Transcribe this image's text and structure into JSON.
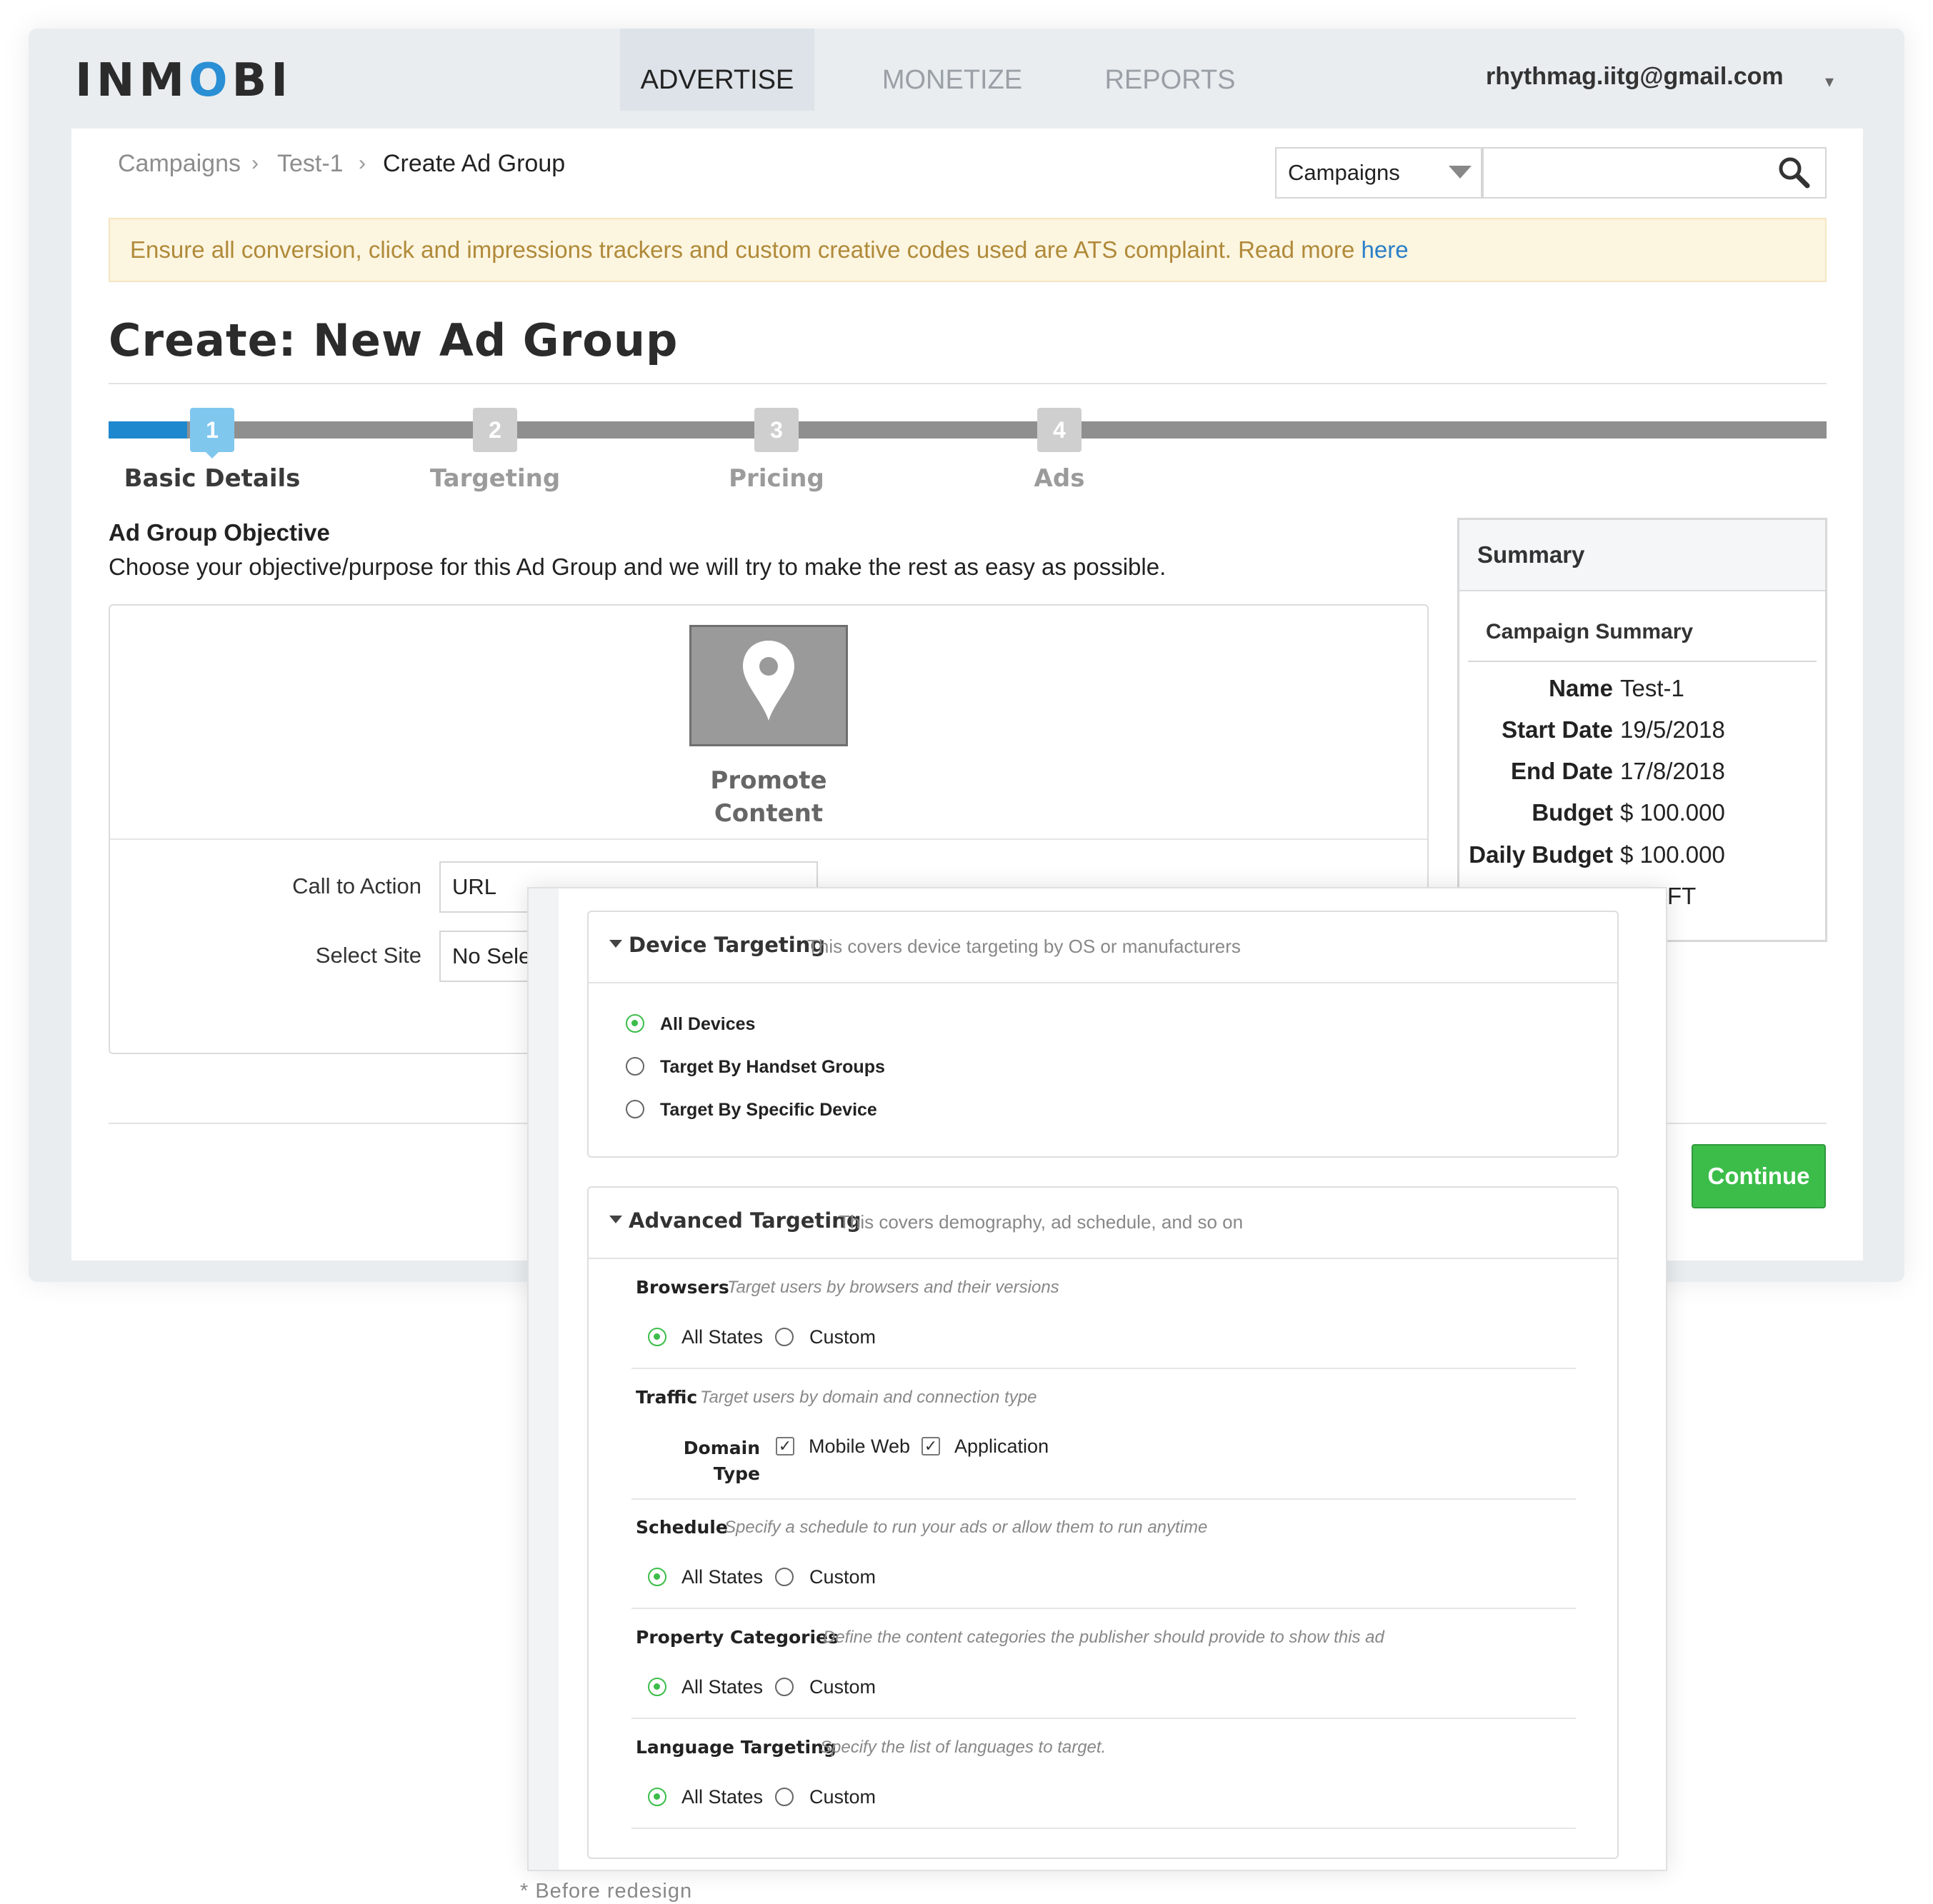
{
  "app": {
    "logo_text": "INMOBI",
    "brand_color": "#2a8fd4",
    "accent_color": "#1e88cf"
  },
  "nav": {
    "tabs": [
      {
        "label": "ADVERTISE",
        "active": true
      },
      {
        "label": "MONETIZE",
        "active": false
      },
      {
        "label": "REPORTS",
        "active": false
      }
    ],
    "user_email": "rhythmag.iitg@gmail.com",
    "user_caret": "▾"
  },
  "breadcrumb": {
    "items": [
      "Campaigns",
      "Test-1",
      "Create Ad Group"
    ],
    "separator": "›"
  },
  "search": {
    "scope": "Campaigns",
    "value": ""
  },
  "notice": {
    "text": "Ensure all conversion, click and impressions trackers and custom creative codes used are ATS complaint. Read more ",
    "link": "here"
  },
  "page": {
    "title": "Create: New Ad Group"
  },
  "steps": [
    {
      "number": "1",
      "label": "Basic Details",
      "active": true
    },
    {
      "number": "2",
      "label": "Targeting",
      "active": false
    },
    {
      "number": "3",
      "label": "Pricing",
      "active": false
    },
    {
      "number": "4",
      "label": "Ads",
      "active": false
    }
  ],
  "objective": {
    "heading": "Ad Group Objective",
    "description": "Choose your objective/purpose for this Ad Group and we will try to make the rest as easy as possible.",
    "option_line1": "Promote",
    "option_line2": "Content",
    "option_icon": "map-pin-icon"
  },
  "form": {
    "cta_label": "Call to Action",
    "cta_value": "URL",
    "site_label": "Select Site",
    "site_value": "No Sele"
  },
  "actions": {
    "continue_label": "Continue",
    "continue_color": "#3cbd4a"
  },
  "summary": {
    "title": "Summary",
    "campaign_title": "Campaign Summary",
    "rows": [
      {
        "key": "Name",
        "value": "Test-1"
      },
      {
        "key": "Start Date",
        "value": "19/5/2018"
      },
      {
        "key": "End Date",
        "value": "17/8/2018"
      },
      {
        "key": "Budget",
        "value": "$ 100.000"
      },
      {
        "key": "Daily Budget",
        "value": "$ 100.000"
      }
    ],
    "partial_text": "FT"
  },
  "device_targeting": {
    "title": "Device Targeting",
    "description": "This covers device targeting by OS or manufacturers",
    "options": [
      {
        "label": "All Devices",
        "selected": true
      },
      {
        "label": "Target By Handset Groups",
        "selected": false
      },
      {
        "label": "Target By Specific Device",
        "selected": false
      }
    ]
  },
  "advanced_targeting": {
    "title": "Advanced Targeting",
    "description": "This covers demography, ad schedule, and so on",
    "browsers": {
      "title": "Browsers",
      "description": "Target users by browsers and their versions",
      "opt1": "All States",
      "opt2": "Custom"
    },
    "traffic": {
      "title": "Traffic",
      "description": "Target users by domain and connection type",
      "domain_label_1": "Domain",
      "domain_label_2": "Type",
      "check1": "Mobile Web",
      "check2": "Application"
    },
    "schedule": {
      "title": "Schedule",
      "description": "Specify a schedule to run your ads or allow them to run anytime",
      "opt1": "All States",
      "opt2": "Custom"
    },
    "property": {
      "title": "Property Categories",
      "description": "Define the content categories the publisher should provide to show this ad",
      "opt1": "All States",
      "opt2": "Custom"
    },
    "language": {
      "title": "Language Targeting",
      "description": "Specify the list of languages to target.",
      "opt1": "All States",
      "opt2": "Custom"
    }
  },
  "footnote": "* Before redesign"
}
